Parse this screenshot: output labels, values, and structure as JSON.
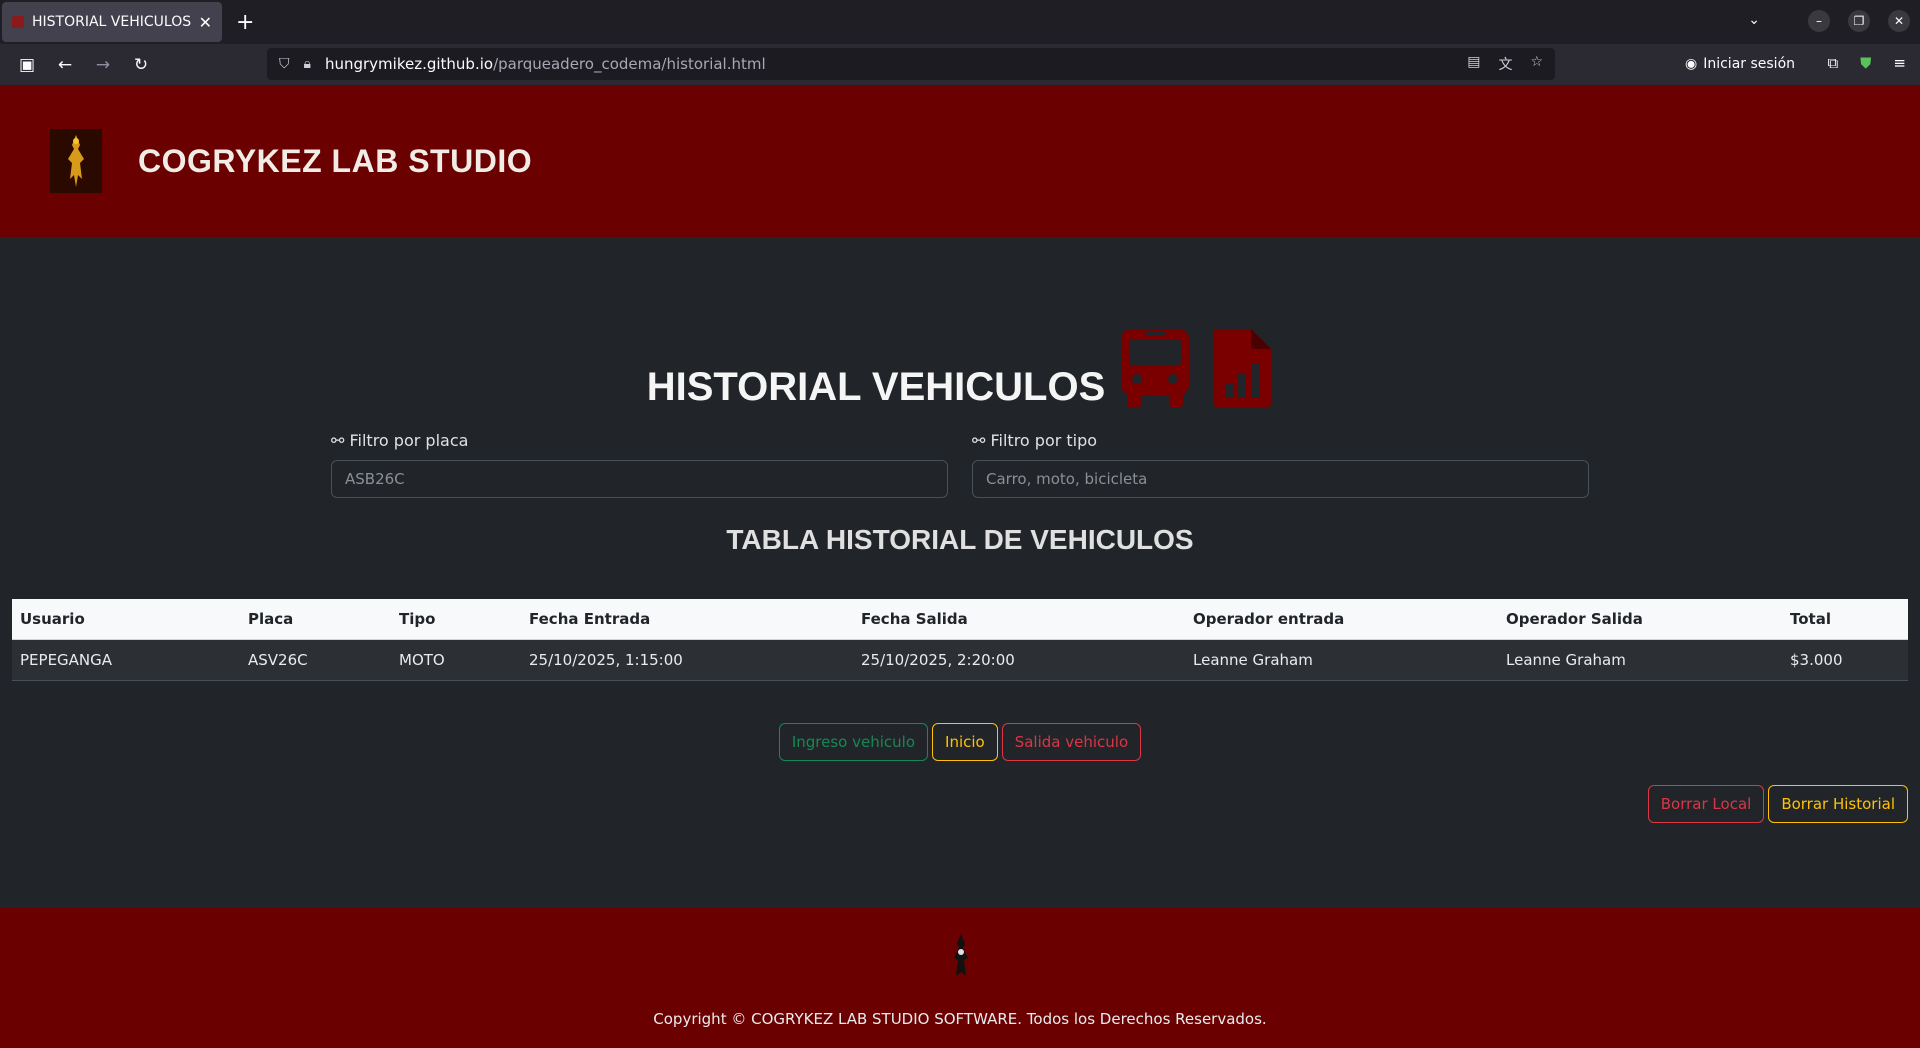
{
  "browser": {
    "tab_title": "HISTORIAL VEHICULOS | C",
    "url_host": "hungrymikez.github.io",
    "url_path": "/parqueadero_codema/historial.html",
    "signin_label": "Iniciar sesión"
  },
  "header": {
    "brand": "COGRYKEZ LAB STUDIO"
  },
  "page": {
    "title": "HISTORIAL VEHICULOS",
    "title_icons": [
      "bus-icon",
      "report-file-icon"
    ]
  },
  "filters": {
    "placa_label": "⚯ Filtro por placa",
    "placa_placeholder": "ASB26C",
    "tipo_label": "⚯ Filtro por tipo",
    "tipo_placeholder": "Carro, moto, bicicleta"
  },
  "table": {
    "title": "TABLA HISTORIAL DE VEHICULOS",
    "headers": [
      "Usuario",
      "Placa",
      "Tipo",
      "Fecha Entrada",
      "Fecha Salida",
      "Operador entrada",
      "Operador Salida",
      "Total"
    ],
    "rows": [
      [
        "PEPEGANGA",
        "ASV26C",
        "MOTO",
        "25/10/2025, 1:15:00",
        "25/10/2025, 2:20:00",
        "Leanne Graham",
        "Leanne Graham",
        "$3.000"
      ]
    ]
  },
  "actions": {
    "ingreso": "Ingreso vehiculo",
    "inicio": "Inicio",
    "salida": "Salida vehiculo",
    "borrar_local": "Borrar Local",
    "borrar_historial": "Borrar Historial"
  },
  "footer": {
    "copyright": "Copyright © COGRYKEZ LAB STUDIO SOFTWARE. Todos los Derechos Reservados."
  },
  "colors": {
    "header_bg": "#6a0000",
    "page_bg": "#212529",
    "icon_red": "#7a0000",
    "success": "#198754",
    "warning": "#ffc107",
    "danger": "#dc3545"
  }
}
